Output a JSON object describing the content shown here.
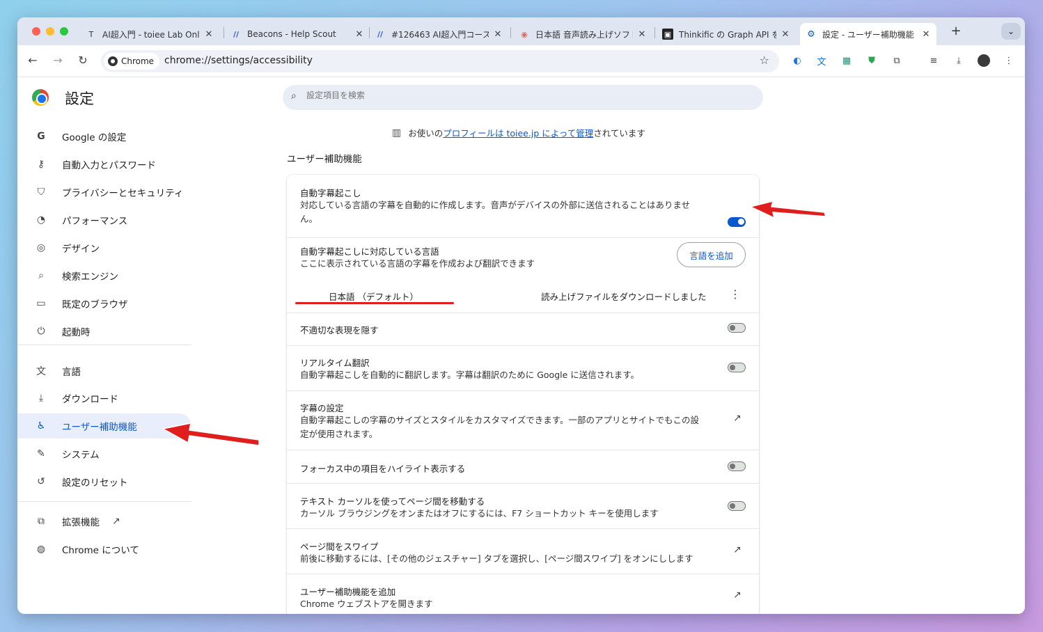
{
  "tabs": [
    {
      "title": "AI超入門 - toiee Lab Onli",
      "favicon": "T"
    },
    {
      "title": "Beacons - Help Scout",
      "favicon": "//"
    },
    {
      "title": "#126463 AI超入門コース",
      "favicon": "//"
    },
    {
      "title": "日本語 音声読み上げソフト",
      "favicon": "◉"
    },
    {
      "title": "Thinkific の Graph API を",
      "favicon": "▣"
    },
    {
      "title": "設定 - ユーザー補助機能",
      "favicon": "⚙"
    }
  ],
  "toolbar": {
    "chip": "Chrome",
    "url": "chrome://settings/accessibility"
  },
  "sidebar": {
    "title": "設定",
    "items": [
      {
        "label": "Google の設定",
        "icon": "G"
      },
      {
        "label": "自動入力とパスワード",
        "icon": "⚷"
      },
      {
        "label": "プライバシーとセキュリティ",
        "icon": "⛉"
      },
      {
        "label": "パフォーマンス",
        "icon": "◔"
      },
      {
        "label": "デザイン",
        "icon": "◎"
      },
      {
        "label": "検索エンジン",
        "icon": "⌕"
      },
      {
        "label": "既定のブラウザ",
        "icon": "▭"
      },
      {
        "label": "起動時",
        "icon": "⏻"
      },
      {
        "label": "言語",
        "icon": "文"
      },
      {
        "label": "ダウンロード",
        "icon": "⤓"
      },
      {
        "label": "ユーザー補助機能",
        "icon": "♿"
      },
      {
        "label": "システム",
        "icon": "✎"
      },
      {
        "label": "設定のリセット",
        "icon": "↺"
      },
      {
        "label": "拡張機能",
        "icon": "⧉"
      },
      {
        "label": "Chrome について",
        "icon": "◍"
      }
    ]
  },
  "search": {
    "placeholder": "設定項目を検索"
  },
  "managed": {
    "prefix": "お使いの",
    "link": "プロフィールは toiee.jp によって管理",
    "suffix": "されています"
  },
  "section_title": "ユーザー補助機能",
  "rows": {
    "captions": {
      "title": "自動字幕起こし",
      "sub1": "対応している言語の字幕を自動的に作成します。音声がデバイスの外部に送信されることはありませ",
      "sub2": "ん。",
      "toggle": true
    },
    "languages": {
      "title": "自動字幕起こしに対応している言語",
      "sub": "ここに表示されている言語の字幕を作成および翻訳できます",
      "button": "言語を追加",
      "lang": "日本語 （デフォルト）",
      "status": "読み上げファイルをダウンロードしました"
    },
    "profanity": {
      "title": "不適切な表現を隠す",
      "toggle": false
    },
    "translate": {
      "title": "リアルタイム翻訳",
      "sub": "自動字幕起こしを自動的に翻訳します。字幕は翻訳のために Google に送信されます。",
      "toggle": false
    },
    "caption_settings": {
      "title": "字幕の設定",
      "sub1": "自動字幕起こしの字幕のサイズとスタイルをカスタマイズできます。一部のアプリとサイトでもこの設",
      "sub2": "定が使用されます。"
    },
    "focus": {
      "title": "フォーカス中の項目をハイライト表示する",
      "toggle": false
    },
    "caret": {
      "title": "テキスト カーソルを使ってページ間を移動する",
      "sub": "カーソル ブラウジングをオンまたはオフにするには、F7 ショートカット キーを使用します",
      "toggle": false
    },
    "swipe": {
      "title": "ページ間をスワイプ",
      "sub": "前後に移動するには、[その他のジェスチャー] タブを選択し、[ページ間スワイプ] をオンにしします"
    },
    "add_features": {
      "title": "ユーザー補助機能を追加",
      "sub": "Chrome ウェブストアを開きます"
    }
  },
  "colors": {
    "accent": "#0b57d0",
    "annotation": "#e01e1e"
  }
}
